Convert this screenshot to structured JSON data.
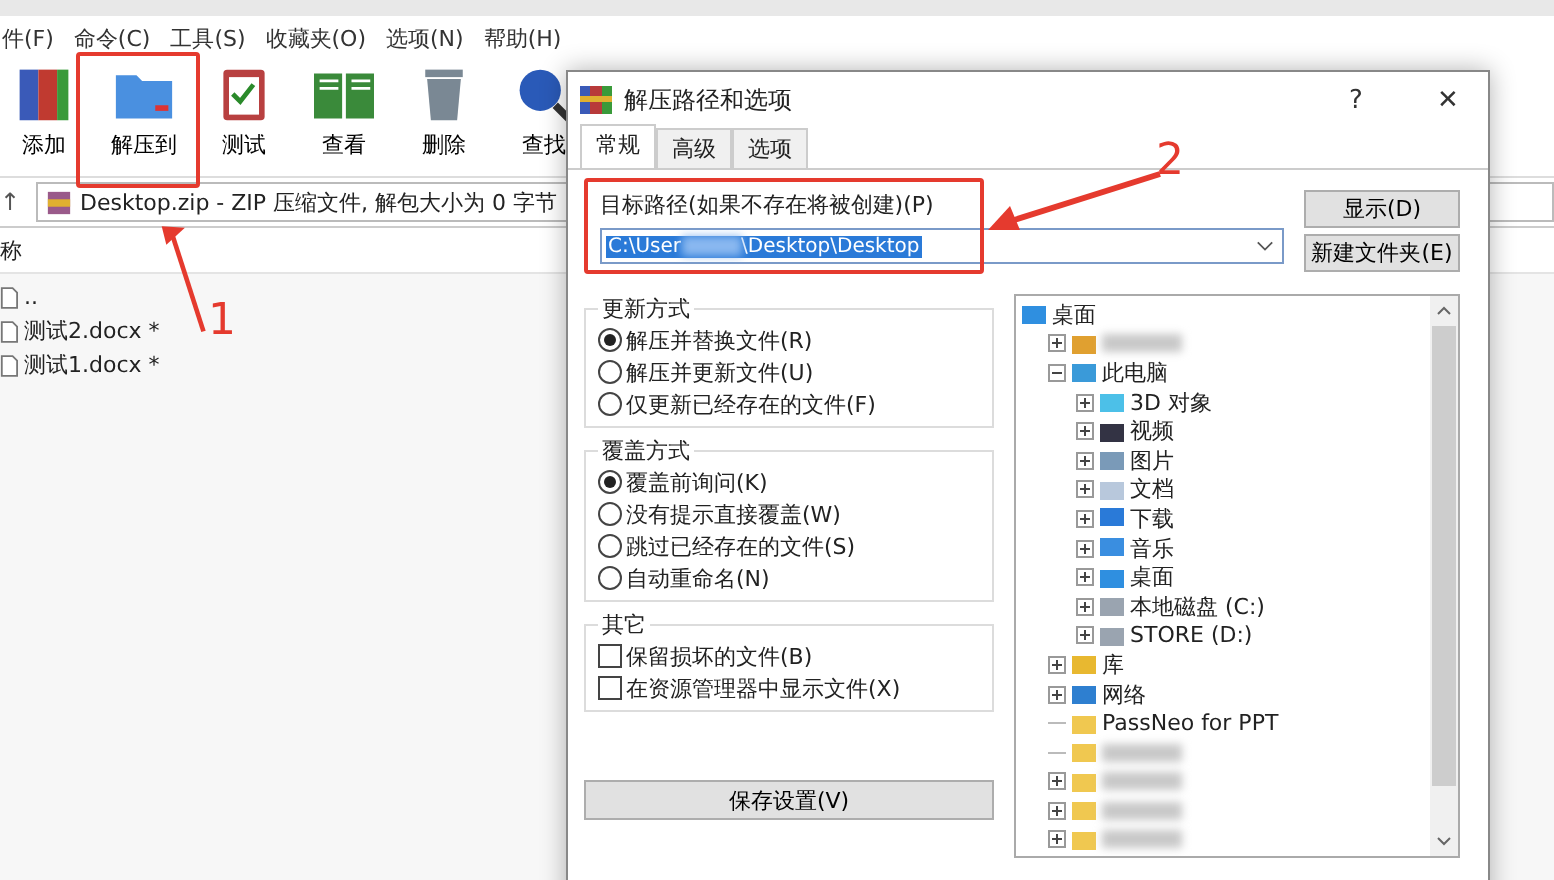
{
  "main_window": {
    "menu": [
      "件(F)",
      "命令(C)",
      "工具(S)",
      "收藏夹(O)",
      "选项(N)",
      "帮助(H)"
    ],
    "toolbar": [
      {
        "label": "添加",
        "kind": "add"
      },
      {
        "label": "解压到",
        "kind": "extract"
      },
      {
        "label": "测试",
        "kind": "test"
      },
      {
        "label": "查看",
        "kind": "view"
      },
      {
        "label": "删除",
        "kind": "delete"
      },
      {
        "label": "查找",
        "kind": "find"
      }
    ],
    "up_arrow": "↑",
    "address": "Desktop.zip - ZIP 压缩文件, 解包大小为 0 字节",
    "column_header": "称",
    "files": [
      {
        "name": ".."
      },
      {
        "name": "测试2.docx *"
      },
      {
        "name": "测试1.docx *"
      }
    ]
  },
  "dialog": {
    "title": "解压路径和选项",
    "help": "?",
    "close": "✕",
    "tabs": [
      {
        "label": "常规",
        "selected": true
      },
      {
        "label": "高级",
        "selected": false
      },
      {
        "label": "选项",
        "selected": false
      }
    ],
    "path_label": "目标路径(如果不存在将被创建)(P)",
    "path_field": {
      "value_start": "C:\\User",
      "value_end": "\\Desktop\\Desktop",
      "selected": true
    },
    "buttons": [
      "显示(D)",
      "新建文件夹(E)"
    ],
    "update_group": {
      "title": "更新方式",
      "options": [
        {
          "label": "解压并替换文件(R)",
          "selected": true
        },
        {
          "label": "解压并更新文件(U)",
          "selected": false
        },
        {
          "label": "仅更新已经存在的文件(F)",
          "selected": false
        }
      ]
    },
    "overwrite_group": {
      "title": "覆盖方式",
      "options": [
        {
          "label": "覆盖前询问(K)",
          "selected": true
        },
        {
          "label": "没有提示直接覆盖(W)",
          "selected": false
        },
        {
          "label": "跳过已经存在的文件(S)",
          "selected": false
        },
        {
          "label": "自动重命名(N)",
          "selected": false
        }
      ]
    },
    "other_group": {
      "title": "其它",
      "options": [
        {
          "label": "保留损坏的文件(B)",
          "checked": false
        },
        {
          "label": "在资源管理器中显示文件(X)",
          "checked": false
        }
      ]
    },
    "save_button": "保存设置(V)",
    "tree": [
      {
        "label": "桌面",
        "kind": "desktop",
        "children": [
          {
            "kind": "user",
            "leaf": false,
            "expanded": false
          },
          {
            "label": "此电脑",
            "kind": "pc",
            "leaf": false,
            "expanded": true,
            "children": [
              {
                "label": "3D 对象",
                "kind": "cube",
                "leaf": false,
                "expanded": false
              },
              {
                "label": "视频",
                "kind": "video",
                "leaf": false,
                "expanded": false
              },
              {
                "label": "图片",
                "kind": "picture",
                "leaf": false,
                "expanded": false
              },
              {
                "label": "文档",
                "kind": "document",
                "leaf": false,
                "expanded": false
              },
              {
                "label": "下载",
                "kind": "download",
                "leaf": false,
                "expanded": false
              },
              {
                "label": "音乐",
                "kind": "music",
                "leaf": false,
                "expanded": false
              },
              {
                "label": "桌面",
                "kind": "desktop",
                "leaf": false,
                "expanded": false
              },
              {
                "label": "本地磁盘 (C:)",
                "kind": "drive",
                "leaf": false,
                "expanded": false
              },
              {
                "label": "STORE (D:)",
                "kind": "drive",
                "leaf": false,
                "expanded": false
              }
            ]
          },
          {
            "label": "库",
            "kind": "library",
            "leaf": false,
            "expanded": false
          },
          {
            "label": "网络",
            "kind": "network",
            "leaf": false,
            "expanded": false
          },
          {
            "label": "PassNeo for PPT",
            "kind": "folder",
            "leaf": true,
            "expanded": false
          },
          {
            "kind": "folder",
            "leaf": true,
            "expanded": false
          },
          {
            "kind": "folder",
            "leaf": false,
            "expanded": false
          },
          {
            "kind": "folder",
            "leaf": false,
            "expanded": false
          },
          {
            "kind": "folder",
            "leaf": false,
            "expanded": false
          }
        ]
      }
    ]
  },
  "annotations": [
    "1",
    "2"
  ]
}
